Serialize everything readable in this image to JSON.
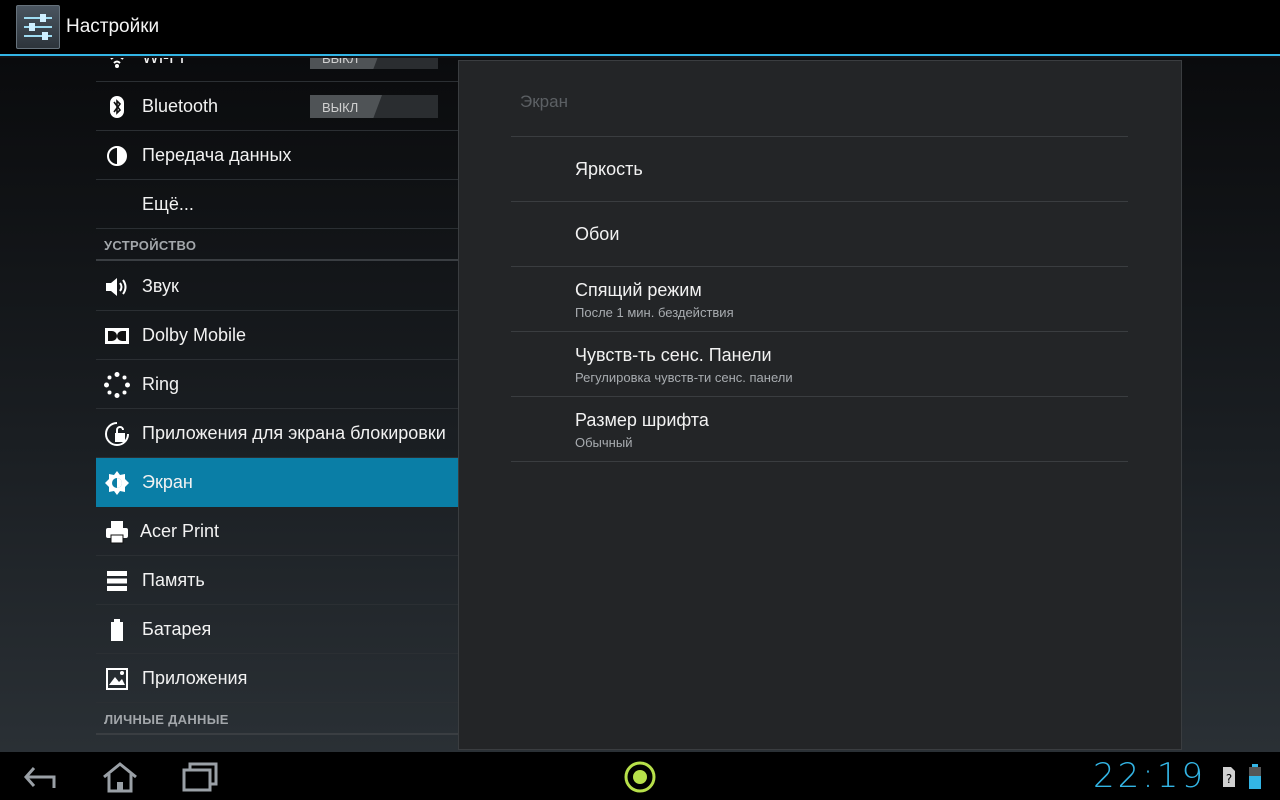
{
  "action_bar": {
    "title": "Настройки",
    "icon": "settings-sliders-icon"
  },
  "left_list": {
    "rows": [
      {
        "label": "Wi-Fi",
        "icon": "wifi-icon",
        "toggle": "ВЫКЛ"
      },
      {
        "label": "Bluetooth",
        "icon": "bluetooth-icon",
        "toggle": "ВЫКЛ"
      },
      {
        "label": "Передача данных",
        "icon": "data-usage-icon"
      },
      {
        "label": "Ещё..."
      }
    ],
    "section_device": "УСТРОЙСТВО",
    "device_rows": [
      {
        "label": "Звук",
        "icon": "speaker-icon"
      },
      {
        "label": "Dolby Mobile",
        "icon": "dolby-icon"
      },
      {
        "label": "Ring",
        "icon": "ring-icon"
      },
      {
        "label": "Приложения для экрана блокировки",
        "icon": "lock-screen-icon"
      },
      {
        "label": "Экран",
        "icon": "brightness-icon",
        "selected": true
      },
      {
        "label": "Acer Print",
        "icon": "printer-icon"
      },
      {
        "label": "Память",
        "icon": "storage-icon"
      },
      {
        "label": "Батарея",
        "icon": "battery-icon"
      },
      {
        "label": "Приложения",
        "icon": "apps-icon"
      }
    ],
    "section_personal": "ЛИЧНЫЕ ДАННЫЕ"
  },
  "detail": {
    "title": "Экран",
    "items": [
      {
        "title": "Яркость",
        "summary": ""
      },
      {
        "title": "Обои",
        "summary": ""
      },
      {
        "title": "Спящий режим",
        "summary": "После 1 мин. бездействия"
      },
      {
        "title": "Чувств-ть сенс. Панели",
        "summary": "Регулировка чувств-ти сенс. панели"
      },
      {
        "title": "Размер шрифта",
        "summary": "Обычный"
      }
    ]
  },
  "nav": {
    "clock": "22:19"
  },
  "colors": {
    "accent": "#33b5e5",
    "selected_row": "#0a7ea6",
    "toggle_off": "#4f5356"
  }
}
